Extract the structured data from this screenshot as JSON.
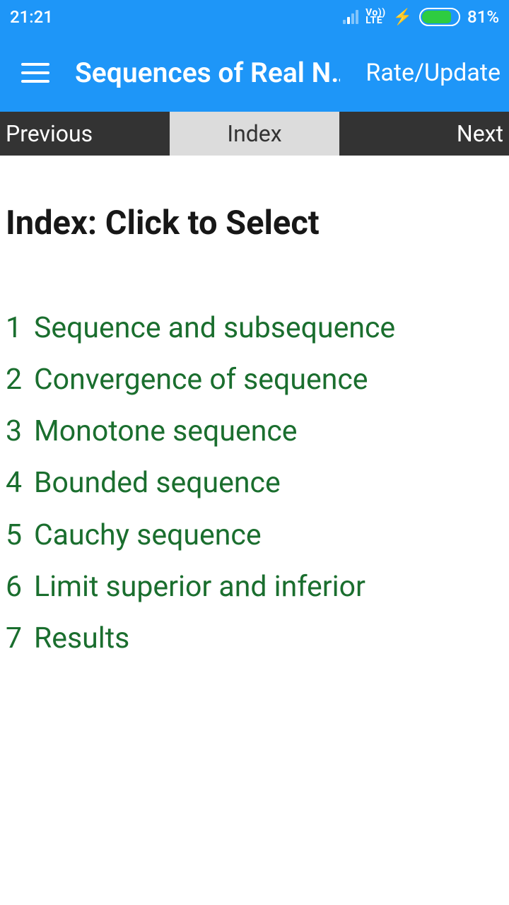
{
  "status": {
    "time": "21:21",
    "volte": "Vo)) LTE",
    "battery_pct": "81%"
  },
  "app": {
    "title": "Sequences of Real N…",
    "rate_label": "Rate/Update"
  },
  "tabs": {
    "previous": "Previous",
    "index": "Index",
    "next": "Next"
  },
  "heading": "Index: Click to Select",
  "items": [
    {
      "n": "1",
      "t": "Sequence and subsequence"
    },
    {
      "n": "2",
      "t": "Convergence of sequence"
    },
    {
      "n": "3",
      "t": "Monotone sequence"
    },
    {
      "n": "4",
      "t": "Bounded sequence"
    },
    {
      "n": "5",
      "t": "Cauchy sequence"
    },
    {
      "n": "6",
      "t": "Limit superior and inferior"
    },
    {
      "n": "7",
      "t": "Results"
    }
  ]
}
